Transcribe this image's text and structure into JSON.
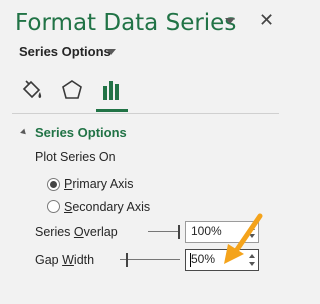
{
  "pane": {
    "title": "Format Data Series",
    "close_label": "✕",
    "options_dropdown_label": "Series Options"
  },
  "tabs": [
    {
      "name": "fill-line"
    },
    {
      "name": "effects"
    },
    {
      "name": "series-options",
      "active": true
    }
  ],
  "section": {
    "title": "Series Options",
    "plot_series_on_label": "Plot Series On",
    "primary_axis_label": "Primary Axis",
    "primary_axis_access_key": "P",
    "primary_axis_rest": "rimary Axis",
    "secondary_axis_label": "Secondary Axis",
    "secondary_axis_access_key": "S",
    "secondary_axis_rest": "econdary Axis",
    "selected_axis": "Primary Axis",
    "series_overlap_label": "Series Overlap",
    "series_overlap_prefix": "Series ",
    "series_overlap_access_key": "O",
    "series_overlap_rest": "verlap",
    "series_overlap_value": "100%",
    "series_overlap_fraction": 1.0,
    "gap_width_label": "Gap Width",
    "gap_width_prefix": "Gap ",
    "gap_width_access_key": "W",
    "gap_width_rest": "idth",
    "gap_width_value": "50%",
    "gap_width_fraction": 0.1
  },
  "colors": {
    "accent": "#217346",
    "annotation_arrow": "#f4a31b"
  }
}
